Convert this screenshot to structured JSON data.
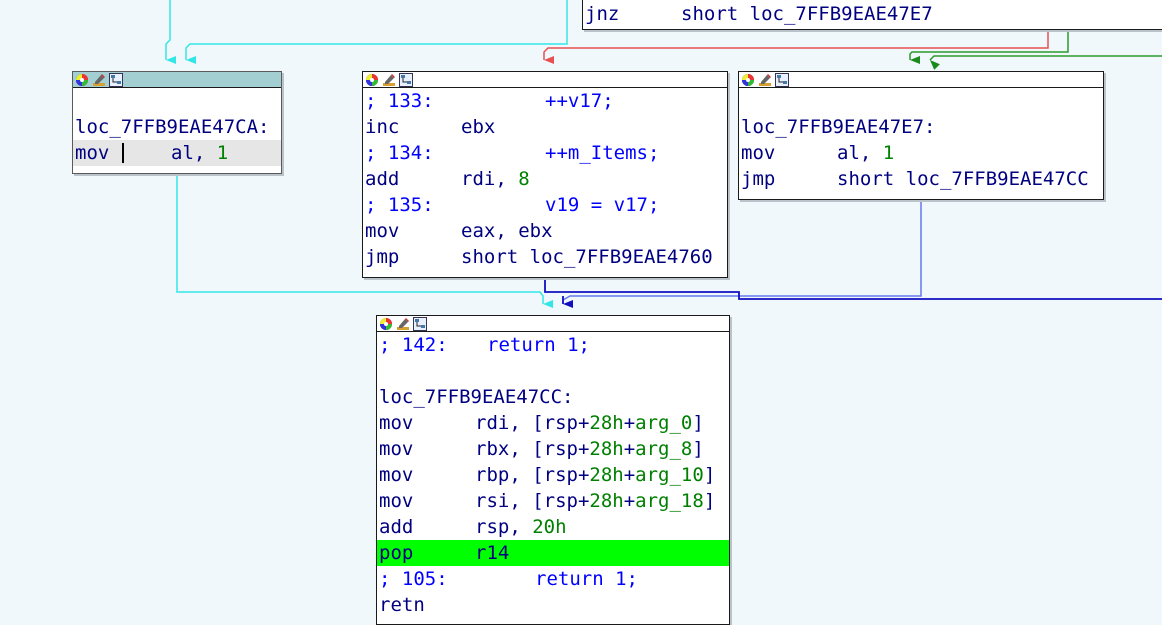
{
  "colors": {
    "background": "#f0f8fc",
    "edge_cyan": "#33e6e6",
    "edge_red": "#e65050",
    "edge_green": "#2a9a2a",
    "edge_blue": "#1010c0",
    "edge_lightblue": "#6677ee",
    "text_navy": "#000080",
    "text_comment": "#0000ff",
    "text_number": "#008000",
    "highlight_green": "#00ff00"
  },
  "icons": [
    "color-wheel-icon",
    "pencil-icon",
    "graph-icon"
  ],
  "nodes": {
    "top": {
      "lines": [
        {
          "mnemonic": "jnz",
          "operand": "short loc_7FFB9EAE47E7"
        }
      ]
    },
    "left": {
      "lines": [
        {
          "label": "loc_7FFB9EAE47CA:"
        },
        {
          "mnemonic": "mov",
          "op_reg": "al,",
          "op_num": "1"
        }
      ]
    },
    "middle": {
      "lines": [
        {
          "comment_prefix": "; 133:",
          "comment_code": "++v17;"
        },
        {
          "mnemonic": "inc",
          "operand": "ebx"
        },
        {
          "comment_prefix": "; 134:",
          "comment_code": "++m_Items;"
        },
        {
          "mnemonic": "add",
          "op_reg": "rdi,",
          "op_num": "8"
        },
        {
          "comment_prefix": "; 135:",
          "comment_code": "v19 = v17;"
        },
        {
          "mnemonic": "mov",
          "operand": "eax, ebx"
        },
        {
          "mnemonic": "jmp",
          "operand": "short loc_7FFB9EAE4760"
        }
      ]
    },
    "right": {
      "lines": [
        {
          "label": "loc_7FFB9EAE47E7:"
        },
        {
          "mnemonic": "mov",
          "op_reg": "al,",
          "op_num": "1"
        },
        {
          "mnemonic": "jmp",
          "operand": "short loc_7FFB9EAE47CC"
        }
      ]
    },
    "bottom": {
      "lines": [
        {
          "comment_prefix": "; 142:",
          "comment_code": "return 1;"
        },
        {
          "label": "loc_7FFB9EAE47CC:"
        },
        {
          "mnemonic": "mov",
          "op_a": "rdi, [rsp+",
          "op_b": "28h",
          "op_c": "+",
          "op_d": "arg_0",
          "op_e": "]"
        },
        {
          "mnemonic": "mov",
          "op_a": "rbx, [rsp+",
          "op_b": "28h",
          "op_c": "+",
          "op_d": "arg_8",
          "op_e": "]"
        },
        {
          "mnemonic": "mov",
          "op_a": "rbp, [rsp+",
          "op_b": "28h",
          "op_c": "+",
          "op_d": "arg_10",
          "op_e": "]"
        },
        {
          "mnemonic": "mov",
          "op_a": "rsi, [rsp+",
          "op_b": "28h",
          "op_c": "+",
          "op_d": "arg_18",
          "op_e": "]"
        },
        {
          "mnemonic": "add",
          "op_reg": "rsp,",
          "op_num": "20h"
        },
        {
          "mnemonic": "pop",
          "operand": "r14"
        },
        {
          "comment_prefix": "; 105:",
          "comment_code": "return 1;"
        },
        {
          "mnemonic": "retn"
        }
      ]
    }
  }
}
